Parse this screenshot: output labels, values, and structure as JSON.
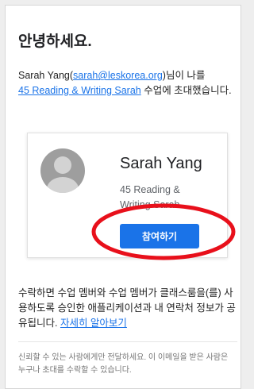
{
  "email": {
    "greeting": "안녕하세요.",
    "invite": {
      "sender_name": "Sarah Yang(",
      "sender_email": "sarah@leskorea.org",
      "text_after_email": ")님이 나를",
      "class_link": "45 Reading & Writing Sarah",
      "text_end": " 수업에 초대했습니다."
    },
    "card": {
      "teacher_name": "Sarah Yang",
      "course_name": "45 Reading & Writing Sarah",
      "join_label": "참여하기"
    },
    "consent": {
      "text": "수락하면 수업 멤버와 수업 멤버가 클래스룸을(를) 사용하도록 승인한 애플리케이션과 내 연락처 정보가 공유됩니다. ",
      "learn_more": "자세히 알아보기"
    },
    "footer": "신뢰할 수 있는 사람에게만 전달하세요. 이 이메일을 받은 사람은 누구나 초대를 수락할 수 있습니다."
  },
  "colors": {
    "link": "#1a73e8",
    "button": "#1a73e8",
    "annotation": "#e8101b"
  },
  "icons": {
    "avatar": "default-person-icon"
  }
}
